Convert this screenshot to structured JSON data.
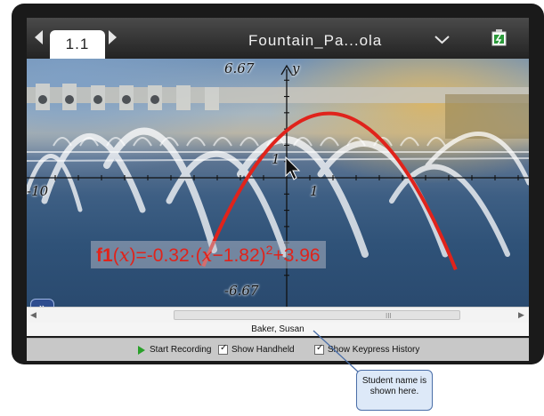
{
  "tab": {
    "label": "1.1"
  },
  "document": {
    "title": "Fountain_Pa...ola"
  },
  "graph": {
    "y_max_label": "6.67",
    "y_min_label": "-6.67",
    "x_min_label": "-10",
    "x_tick_label": "1",
    "y_tick_label": "1",
    "y_axis_name": "y",
    "function": {
      "name": "f1",
      "argument": "x",
      "prefix": "=-0.32·",
      "open_paren": "(",
      "body": "−1.82)",
      "exponent": "2",
      "suffix": "+3.96",
      "color": "#e0231b"
    }
  },
  "student": {
    "name": "Baker, Susan"
  },
  "toolbar": {
    "start_recording": "Start Recording",
    "show_handheld": "Show Handheld",
    "show_keypress_history": "Show Keypress History"
  },
  "callout": {
    "text": "Student name is shown here."
  }
}
